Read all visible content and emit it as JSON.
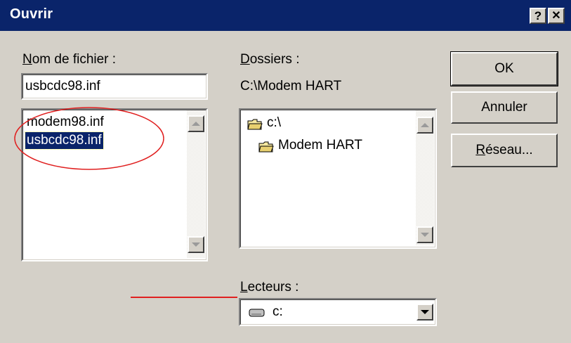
{
  "window": {
    "title": "Ouvrir"
  },
  "titlebar_buttons": {
    "help": "?",
    "close": "✕"
  },
  "filename": {
    "label_u": "N",
    "label_rest": "om de fichier :",
    "value": "usbcdc98.inf",
    "files": [
      "modem98.inf",
      "usbcdc98.inf"
    ],
    "selected_index": 1
  },
  "folders": {
    "label_u": "D",
    "label_rest": "ossiers :",
    "current_path": "C:\\Modem HART",
    "tree": [
      "c:\\",
      "Modem HART"
    ]
  },
  "drives": {
    "label_u": "L",
    "label_rest": "ecteurs :",
    "value": "c:"
  },
  "buttons": {
    "ok": "OK",
    "cancel": "Annuler",
    "network_u": "R",
    "network_rest": "éseau..."
  },
  "annotations": {
    "circle_color": "#e02020",
    "underline_color": "#e02020"
  }
}
